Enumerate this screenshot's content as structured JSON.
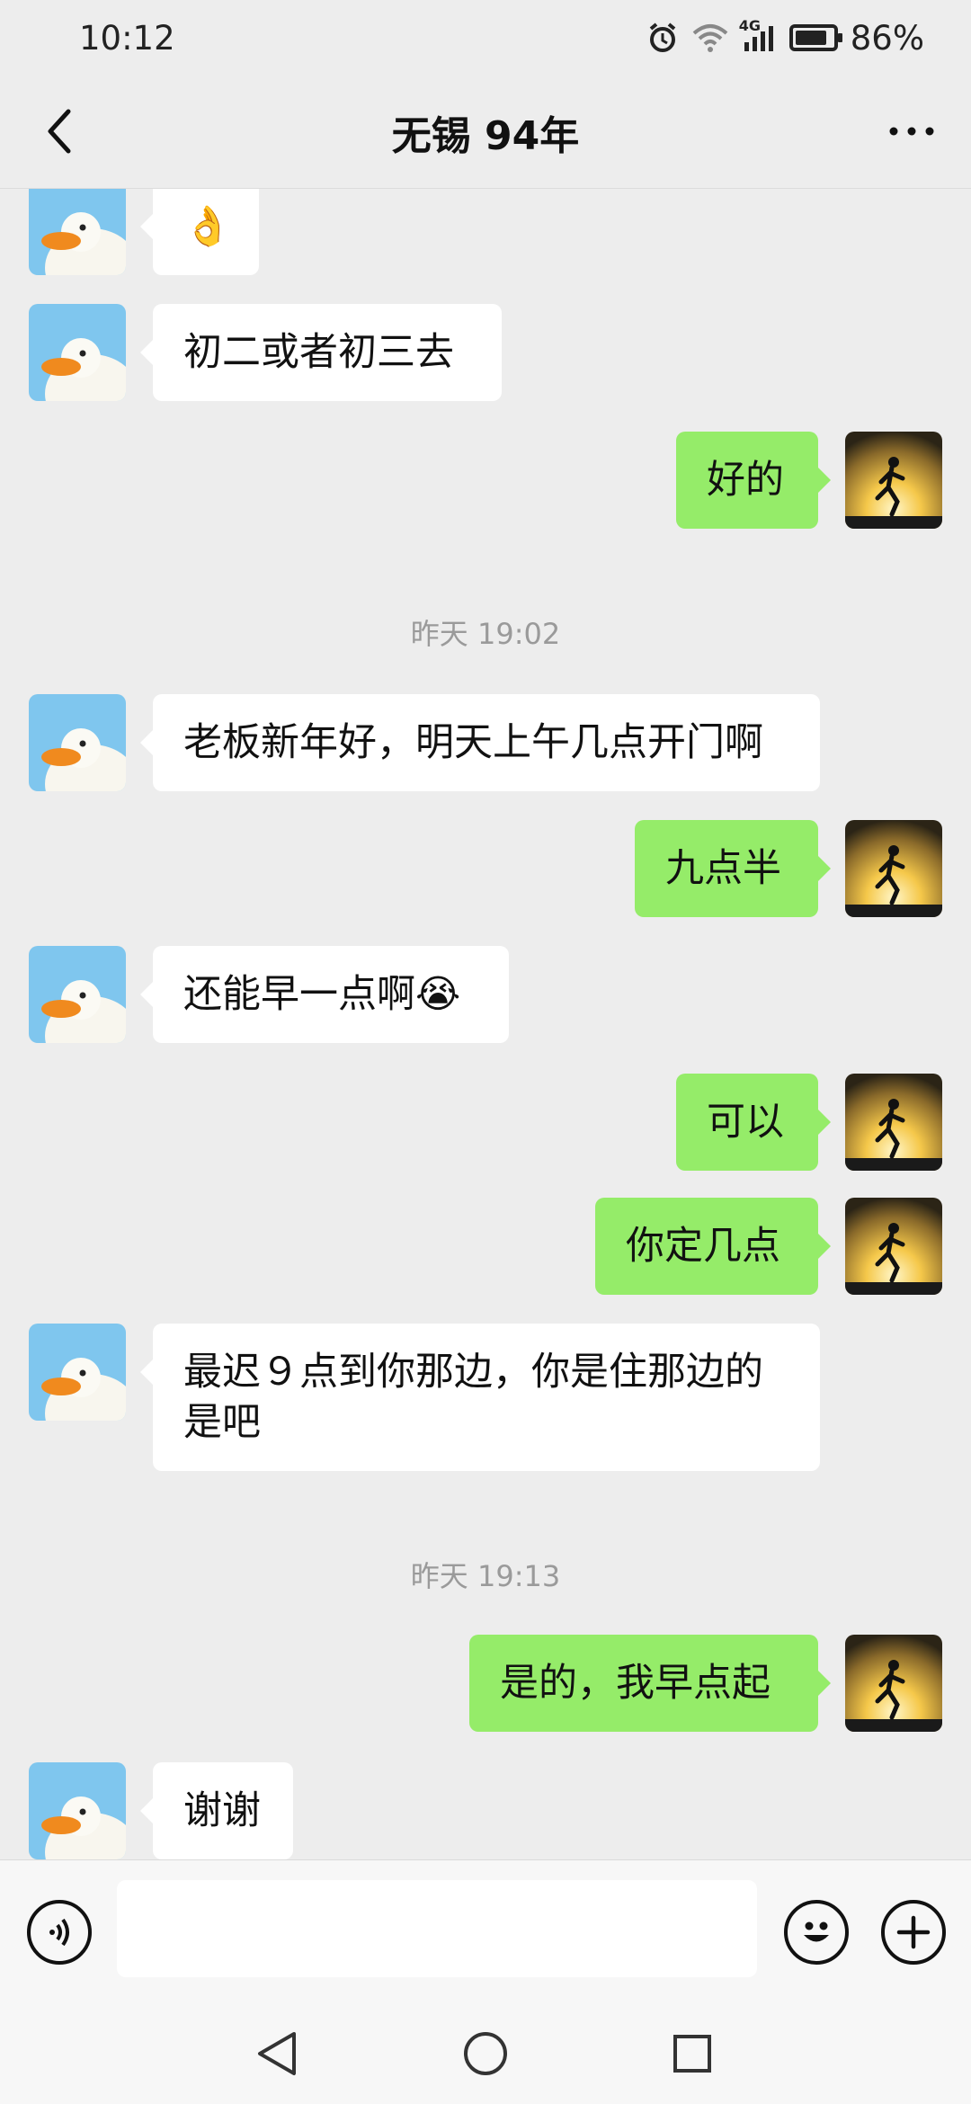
{
  "status": {
    "time": "10:12",
    "network_label": "4G",
    "battery_percent": "86%",
    "battery_level": 0.86
  },
  "header": {
    "title": "无锡 94年",
    "back_icon": "chevron-left-icon",
    "more_icon": "more-dots-icon"
  },
  "messages": [
    {
      "side": "left",
      "text": "👌"
    },
    {
      "side": "left",
      "text": "初二或者初三去"
    },
    {
      "side": "right",
      "text": "好的"
    },
    {
      "timestamp": "昨天 19:02"
    },
    {
      "side": "left",
      "text": "老板新年好，明天上午几点开门啊"
    },
    {
      "side": "right",
      "text": "九点半"
    },
    {
      "side": "left",
      "text": "还能早一点啊😭"
    },
    {
      "side": "right",
      "text": "可以"
    },
    {
      "side": "right",
      "text": "你定几点"
    },
    {
      "side": "left",
      "text": "最迟９点到你那边，你是住那边的\n是吧"
    },
    {
      "timestamp": "昨天 19:13"
    },
    {
      "side": "right",
      "text": "是的，我早点起"
    },
    {
      "side": "left",
      "text": "谢谢"
    }
  ],
  "input": {
    "value": "",
    "voice_icon": "voice-icon",
    "emoji_icon": "emoji-icon",
    "plus_icon": "plus-icon"
  },
  "navigation": {
    "back_icon": "nav-back-icon",
    "home_icon": "nav-home-icon",
    "recents_icon": "nav-recents-icon"
  },
  "colors": {
    "background": "#ededed",
    "sent_bubble": "#95ec69",
    "received_bubble": "#ffffff",
    "timestamp_text": "#9a9a9a"
  }
}
